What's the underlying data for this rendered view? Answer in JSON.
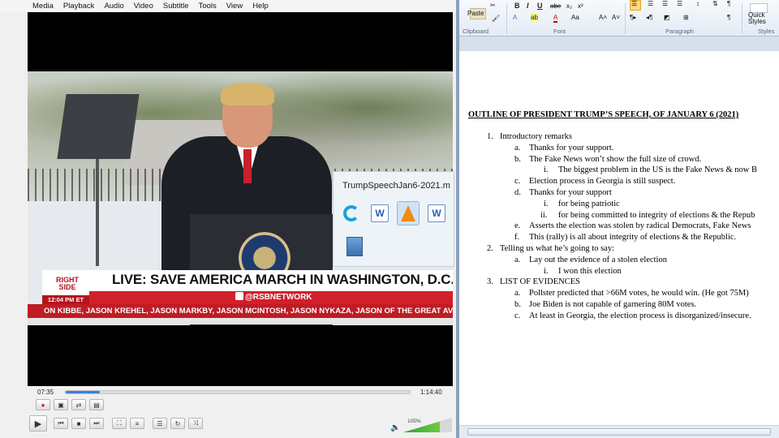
{
  "vlc": {
    "menu": [
      "Media",
      "Playback",
      "Audio",
      "Video",
      "Subtitle",
      "Tools",
      "View",
      "Help"
    ],
    "video": {
      "broadcast_title": "LIVE: SAVE AMERICA MARCH IN WASHINGTON, D.C.",
      "handle": "@RSBNETWORK",
      "logo_line1": "RIGHT",
      "logo_line2": "SIDE",
      "logo_time": "12:04 PM ET",
      "ticker": "ON KIBBE, JASON KREHEL, JASON MARKBY, JASON MCINTOSH, JASON NYKAZA, JASON OF THE GREAT AV"
    },
    "time_elapsed": "07:35",
    "time_total": "1:14:40",
    "progress_fraction": 0.1,
    "volume_label": "105%",
    "volume_fraction": 0.75,
    "colors": {
      "seek": "#3b82d6",
      "volume": "#2aa33c",
      "ticker": "#bf1c24"
    }
  },
  "thumbnail_popup": {
    "title": "TrumpSpeechJan6-2021.m",
    "icons": [
      "swirl-app-icon",
      "word-icon",
      "vlc-icon",
      "word-icon",
      "file-icon"
    ]
  },
  "word": {
    "ribbon": {
      "paste": "Paste",
      "clipboard": "Clipboard",
      "font": "Font",
      "paragraph": "Paragraph",
      "styles": "Styles",
      "quick_styles": "Quick",
      "quick_styles2": "Styles",
      "abe": "abe",
      "aa": "Aa"
    },
    "doc": {
      "title": "OUTLINE OF PRESIDENT TRUMP’S SPEECH, OF JANUARY 6 (2021)",
      "lines": [
        {
          "n": "1.",
          "t": "Introductory remarks"
        },
        {
          "n": "a.",
          "t": "Thanks for your support."
        },
        {
          "n": "b.",
          "t": "The Fake News won’t show the full size of crowd."
        },
        {
          "n": "i.",
          "t": "The biggest problem in the US is the Fake News & now B"
        },
        {
          "n": "c.",
          "t": "Election process in Georgia is still suspect."
        },
        {
          "n": "d.",
          "t": "Thanks for your support"
        },
        {
          "n": "i.",
          "t": "for being patriotic"
        },
        {
          "n": "ii.",
          "t": "for being committed to integrity of elections & the Repub"
        },
        {
          "n": "e.",
          "t": "Asserts the election was stolen by radical Democrats, Fake News"
        },
        {
          "n": "f.",
          "t": "This (rally) is all about integrity of elections & the Republic."
        },
        {
          "n": "2.",
          "t": "Telling us what he’s going to say:"
        },
        {
          "n": "a.",
          "t": "Lay out the evidence of a stolen election"
        },
        {
          "n": "i.",
          "t": "I won this election"
        },
        {
          "n": "3.",
          "t": "LIST OF EVIDENCES"
        },
        {
          "n": "a.",
          "t": "Pollster predicted that >66M votes, he would win.  (He got 75M)"
        },
        {
          "n": "b.",
          "t": "Joe Biden is not capable of garnering 80M votes."
        },
        {
          "n": "c.",
          "t": "At least in Georgia, the election process is disorganized/insecure."
        }
      ]
    }
  }
}
